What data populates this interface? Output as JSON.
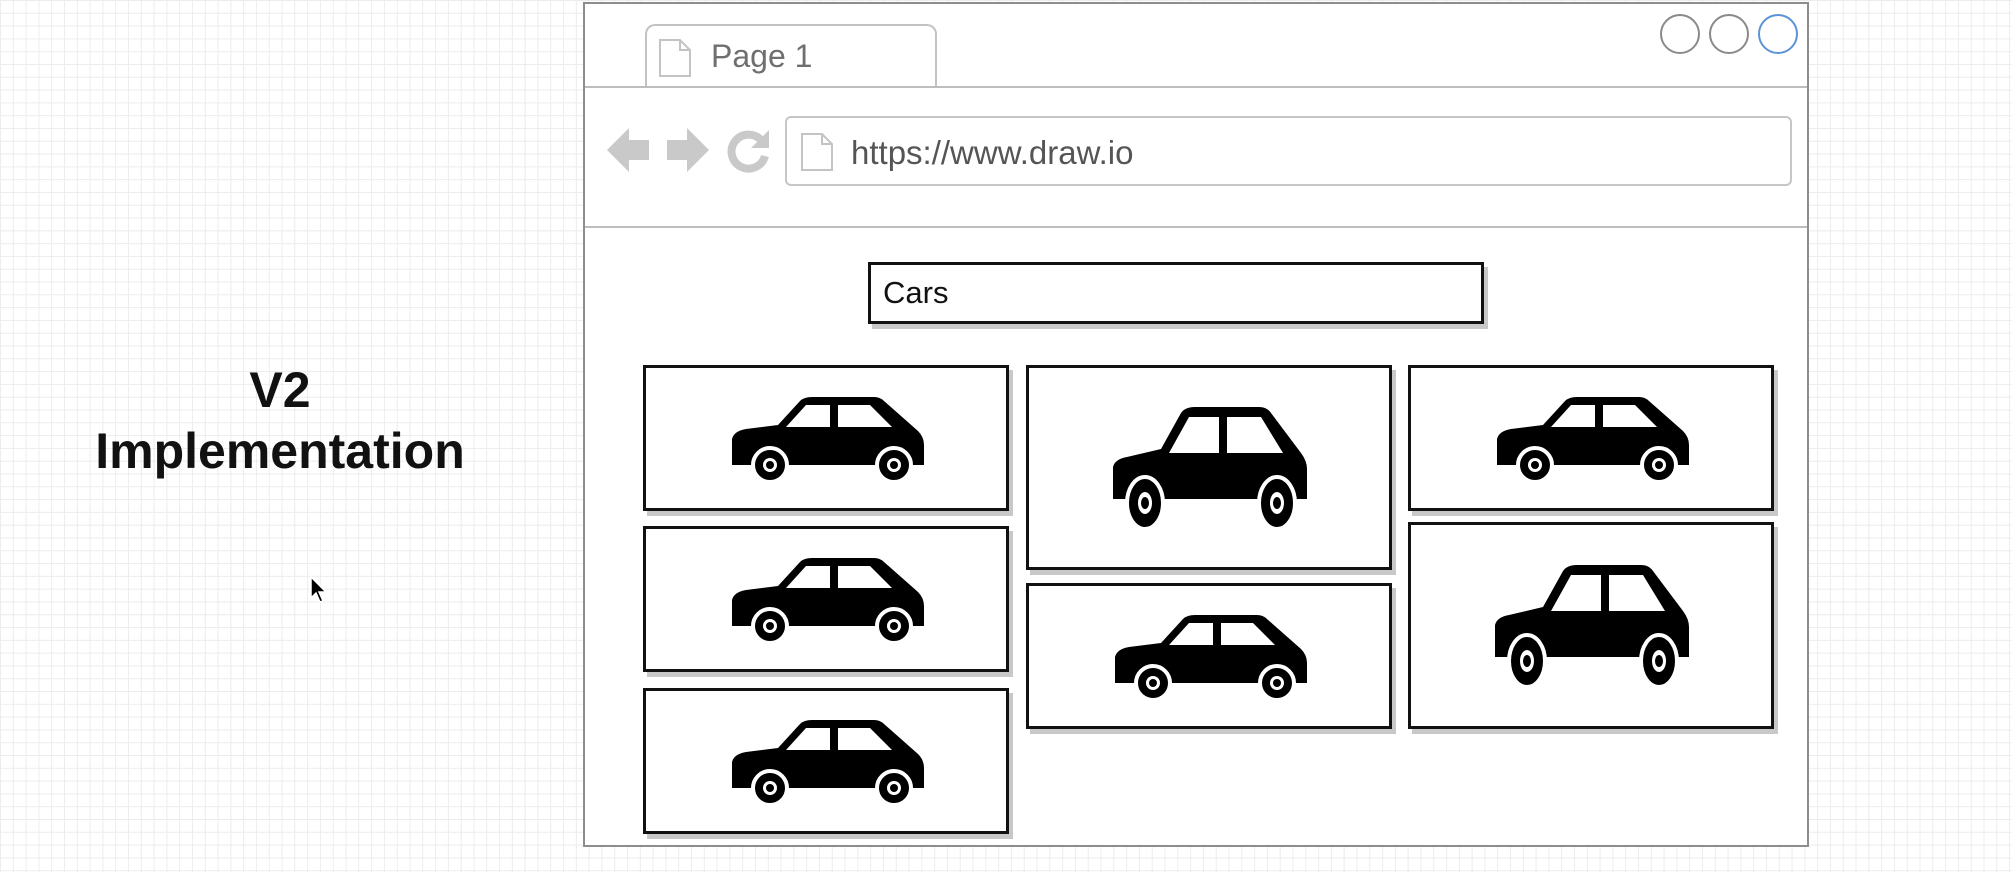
{
  "heading": {
    "line1": "V2",
    "line2": "Implementation"
  },
  "browser": {
    "tab_label": "Page 1",
    "url": "https://www.draw.io",
    "window_buttons": [
      "minimize-button",
      "maximize-button",
      "close-button"
    ],
    "accent_color": "#5b93d6"
  },
  "content": {
    "search_value": "Cars",
    "cards": [
      {
        "column": 1,
        "size": "short",
        "icon": "car-icon"
      },
      {
        "column": 1,
        "size": "short",
        "icon": "car-icon"
      },
      {
        "column": 1,
        "size": "short",
        "icon": "car-icon"
      },
      {
        "column": 2,
        "size": "tall",
        "icon": "car-icon"
      },
      {
        "column": 2,
        "size": "short",
        "icon": "car-icon"
      },
      {
        "column": 3,
        "size": "short",
        "icon": "car-icon"
      },
      {
        "column": 3,
        "size": "tall",
        "icon": "car-icon"
      }
    ]
  }
}
